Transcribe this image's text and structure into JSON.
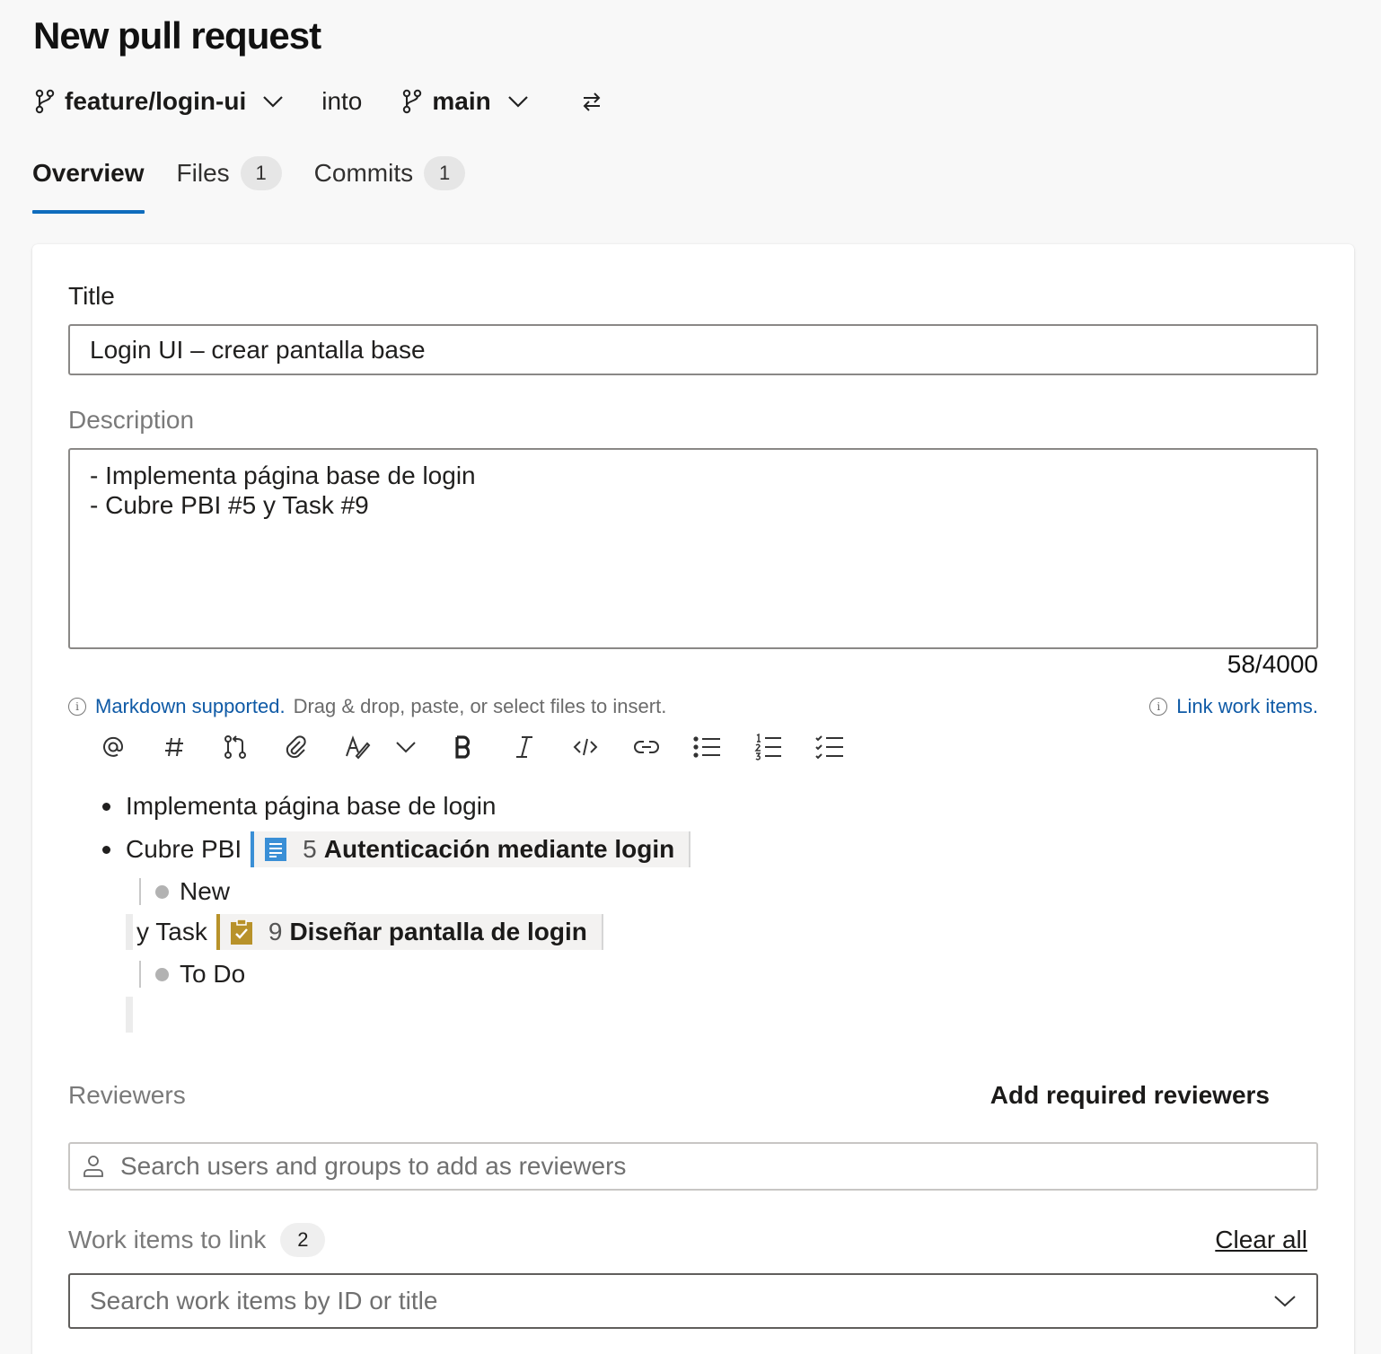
{
  "page": {
    "title": "New pull request"
  },
  "branches": {
    "source": "feature/login-ui",
    "connector": "into",
    "target": "main"
  },
  "tabs": [
    {
      "label": "Overview",
      "active": true
    },
    {
      "label": "Files",
      "count": "1"
    },
    {
      "label": "Commits",
      "count": "1"
    }
  ],
  "form": {
    "title_label": "Title",
    "title_value": "Login UI – crear pantalla base",
    "description_label": "Description",
    "description_value": "- Implementa página base de login\n- Cubre PBI #5 y Task #9",
    "char_count": "58/4000",
    "markdown_link": "Markdown supported.",
    "hint_text": "Drag & drop, paste, or select files to insert.",
    "link_work_items": "Link work items."
  },
  "toolbar": {
    "icons": [
      "mention-icon",
      "hashtag-icon",
      "pull-request-icon",
      "attachment-icon",
      "format-icon",
      "chevron-down-icon",
      "bold-icon",
      "italic-icon",
      "code-icon",
      "link-icon",
      "bulleted-list-icon",
      "numbered-list-icon",
      "checklist-icon"
    ]
  },
  "preview": {
    "line1": "Implementa página base de login",
    "line2_prefix": "Cubre PBI",
    "pbi": {
      "id": "5",
      "title": "Autenticación mediante login",
      "state": "New",
      "color": "#3a8fd6"
    },
    "line3_prefix": "y Task",
    "task": {
      "id": "9",
      "title": "Diseñar pantalla de login",
      "state": "To Do",
      "color": "#b8922a"
    }
  },
  "reviewers": {
    "label": "Reviewers",
    "add_required": "Add required reviewers",
    "search_placeholder": "Search users and groups to add as reviewers"
  },
  "work_items": {
    "label": "Work items to link",
    "count": "2",
    "clear_all": "Clear all",
    "search_placeholder": "Search work items by ID or title"
  },
  "colors": {
    "accent": "#0f6cbd",
    "link": "#0f5aa6"
  }
}
